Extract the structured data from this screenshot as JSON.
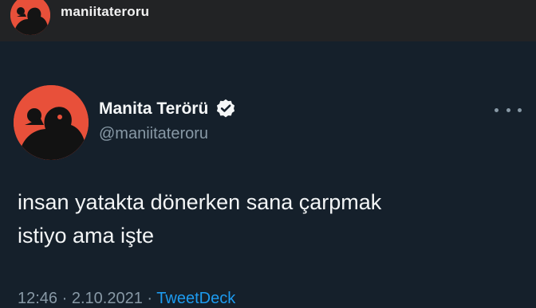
{
  "header": {
    "username": "maniitateroru"
  },
  "tweet": {
    "display_name": "Manita Terörü",
    "verified": true,
    "handle": "@maniitateroru",
    "text_line1": "insan yatakta dönerken sana çarpmak",
    "text_line2": "istiyo ama işte",
    "time": "12:46",
    "separator": "·",
    "date": "2.10.2021",
    "source": "TweetDeck"
  },
  "colors": {
    "background": "#15202b",
    "topbar": "#222325",
    "accent": "#1d9bf0",
    "avatar_bg": "#e8503a"
  },
  "icons": {
    "verified": "verified-badge-icon",
    "more": "more-options-icon"
  }
}
